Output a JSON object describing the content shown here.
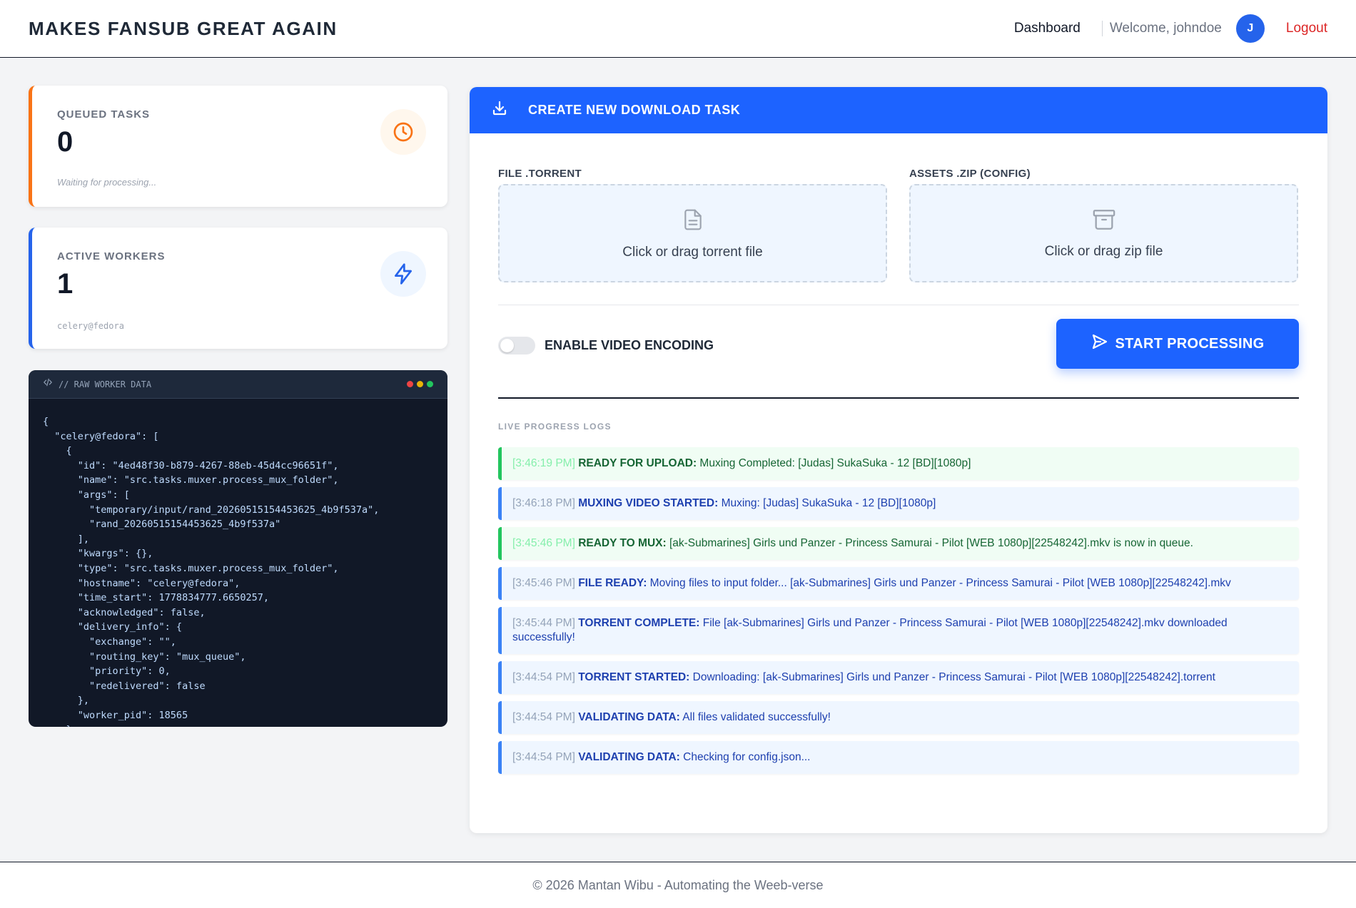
{
  "header": {
    "brand": "MAKES FANSUB GREAT AGAIN",
    "nav_dashboard": "Dashboard",
    "welcome": "Welcome, johndoe",
    "avatar_initial": "J",
    "logout": "Logout"
  },
  "stats": {
    "queued": {
      "label": "QUEUED TASKS",
      "value": "0",
      "sub": "Waiting for processing..."
    },
    "workers": {
      "label": "ACTIVE WORKERS",
      "value": "1",
      "sub": "celery@fedora"
    }
  },
  "terminal": {
    "title": "// RAW WORKER DATA",
    "content": "{\n  \"celery@fedora\": [\n    {\n      \"id\": \"4ed48f30-b879-4267-88eb-45d4cc96651f\",\n      \"name\": \"src.tasks.muxer.process_mux_folder\",\n      \"args\": [\n        \"temporary/input/rand_20260515154453625_4b9f537a\",\n        \"rand_20260515154453625_4b9f537a\"\n      ],\n      \"kwargs\": {},\n      \"type\": \"src.tasks.muxer.process_mux_folder\",\n      \"hostname\": \"celery@fedora\",\n      \"time_start\": 1778834777.6650257,\n      \"acknowledged\": false,\n      \"delivery_info\": {\n        \"exchange\": \"\",\n        \"routing_key\": \"mux_queue\",\n        \"priority\": 0,\n        \"redelivered\": false\n      },\n      \"worker_pid\": 18565\n    }"
  },
  "panel": {
    "title": "CREATE NEW DOWNLOAD TASK",
    "torrent_label": "FILE .TORRENT",
    "torrent_text": "Click or drag torrent file",
    "zip_label": "ASSETS .ZIP (CONFIG)",
    "zip_text": "Click or drag zip file",
    "encoding_label": "ENABLE VIDEO ENCODING",
    "encoding_enabled": false,
    "start_label": "START PROCESSING",
    "logs_label": "LIVE PROGRESS LOGS"
  },
  "logs": [
    {
      "time": "[3:46:19 PM]",
      "status": "READY FOR UPLOAD:",
      "message": " Muxing Completed: [Judas] SukaSuka - 12 [BD][1080p]",
      "kind": "success"
    },
    {
      "time": "[3:46:18 PM]",
      "status": "MUXING VIDEO STARTED:",
      "message": " Muxing: [Judas] SukaSuka - 12 [BD][1080p]",
      "kind": "info"
    },
    {
      "time": "[3:45:46 PM]",
      "status": "READY TO MUX:",
      "message": " [ak-Submarines] Girls und Panzer - Princess Samurai - Pilot [WEB 1080p][22548242].mkv is now in queue.",
      "kind": "success"
    },
    {
      "time": "[3:45:46 PM]",
      "status": "FILE READY:",
      "message": " Moving files to input folder... [ak-Submarines] Girls und Panzer - Princess Samurai - Pilot [WEB 1080p][22548242].mkv",
      "kind": "info"
    },
    {
      "time": "[3:45:44 PM]",
      "status": "TORRENT COMPLETE:",
      "message": " File [ak-Submarines] Girls und Panzer - Princess Samurai - Pilot [WEB 1080p][22548242].mkv downloaded successfully!",
      "kind": "info"
    },
    {
      "time": "[3:44:54 PM]",
      "status": "TORRENT STARTED:",
      "message": " Downloading: [ak-Submarines] Girls und Panzer - Princess Samurai - Pilot [WEB 1080p][22548242].torrent",
      "kind": "info"
    },
    {
      "time": "[3:44:54 PM]",
      "status": "VALIDATING DATA:",
      "message": " All files validated successfully!",
      "kind": "info"
    },
    {
      "time": "[3:44:54 PM]",
      "status": "VALIDATING DATA:",
      "message": " Checking for config.json...",
      "kind": "info"
    }
  ],
  "footer": {
    "text": "© 2026 Mantan Wibu - Automating the Weeb-verse"
  },
  "colors": {
    "accent": "#1d63ff",
    "orange": "#f97316",
    "success": "#22c55e",
    "danger": "#dc2626"
  }
}
